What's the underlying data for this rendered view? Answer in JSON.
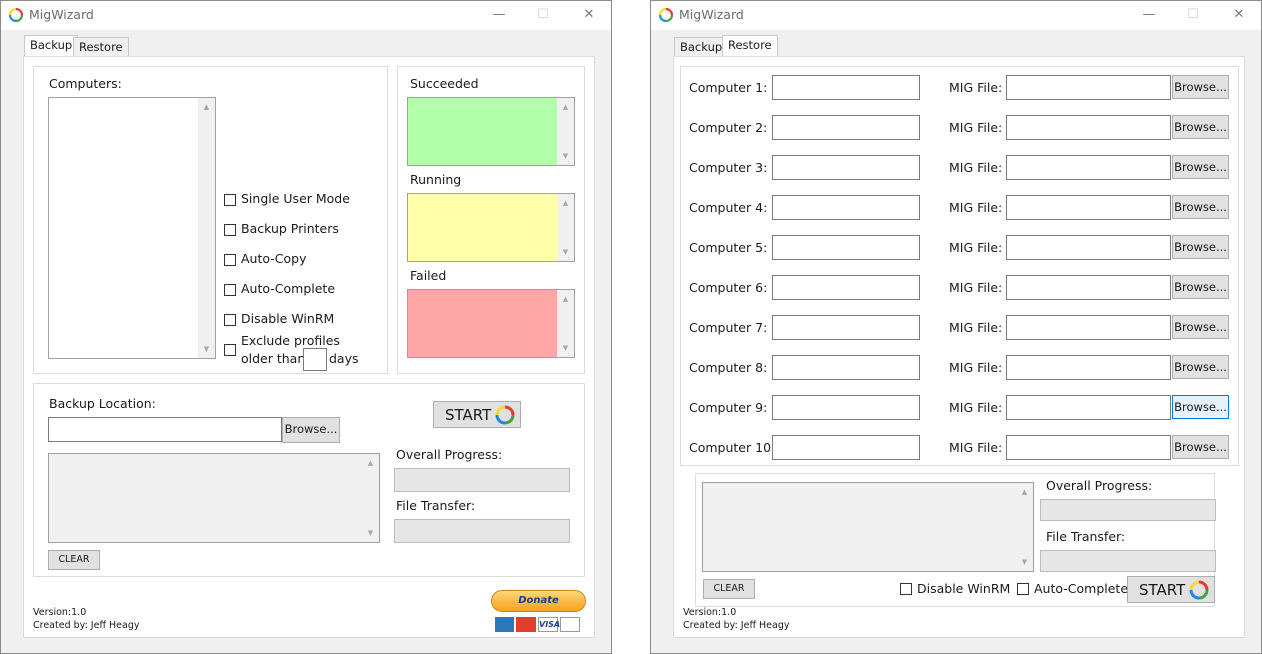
{
  "windows": [
    {
      "title": "MigWizard",
      "tabs": [
        "Backup",
        "Restore"
      ],
      "active_tab": "Backup",
      "computers_label": "Computers:",
      "options": [
        "Single User Mode",
        "Backup Printers",
        "Auto-Copy",
        "Auto-Complete",
        "Disable WinRM"
      ],
      "exclude_line1": "Exclude profiles",
      "exclude_line2": "older than",
      "exclude_days": "days",
      "status_boxes": [
        {
          "label": "Succeeded",
          "color": "#b3ffa9"
        },
        {
          "label": "Running",
          "color": "#ffffa9"
        },
        {
          "label": "Failed",
          "color": "#ffa7a7"
        }
      ],
      "backup_location_label": "Backup Location:",
      "browse_label": "Browse...",
      "start_label": "START",
      "overall_progress_label": "Overall Progress:",
      "file_transfer_label": "File Transfer:",
      "clear_label": "CLEAR",
      "donate_label": "Donate",
      "version": "Version:1.0",
      "created_by": "Created by: Jeff Heagy"
    },
    {
      "title": "MigWizard",
      "tabs": [
        "Backup",
        "Restore"
      ],
      "active_tab": "Restore",
      "rows": [
        {
          "computer": "Computer 1:",
          "mig": "MIG File:",
          "browse": "Browse..."
        },
        {
          "computer": "Computer 2:",
          "mig": "MIG File:",
          "browse": "Browse..."
        },
        {
          "computer": "Computer 3:",
          "mig": "MIG File:",
          "browse": "Browse..."
        },
        {
          "computer": "Computer 4:",
          "mig": "MIG File:",
          "browse": "Browse..."
        },
        {
          "computer": "Computer 5:",
          "mig": "MIG File:",
          "browse": "Browse..."
        },
        {
          "computer": "Computer 6:",
          "mig": "MIG File:",
          "browse": "Browse..."
        },
        {
          "computer": "Computer 7:",
          "mig": "MIG File:",
          "browse": "Browse..."
        },
        {
          "computer": "Computer 8:",
          "mig": "MIG File:",
          "browse": "Browse..."
        },
        {
          "computer": "Computer 9:",
          "mig": "MIG File:",
          "browse": "Browse..."
        },
        {
          "computer": "Computer 10:",
          "mig": "MIG File:",
          "browse": "Browse..."
        }
      ],
      "overall_progress_label": "Overall Progress:",
      "file_transfer_label": "File Transfer:",
      "clear_label": "CLEAR",
      "disable_winrm_label": "Disable WinRM",
      "auto_complete_label": "Auto-Complete",
      "start_label": "START",
      "version": "Version:1.0",
      "created_by": "Created by: Jeff Heagy"
    }
  ],
  "colors": {
    "accent": "#0078d7",
    "donate": "#f7a21c"
  },
  "icons": [
    "app-icon",
    "minimize-icon",
    "maximize-icon",
    "close-icon",
    "refresh-cycle-icon",
    "card-logos"
  ]
}
